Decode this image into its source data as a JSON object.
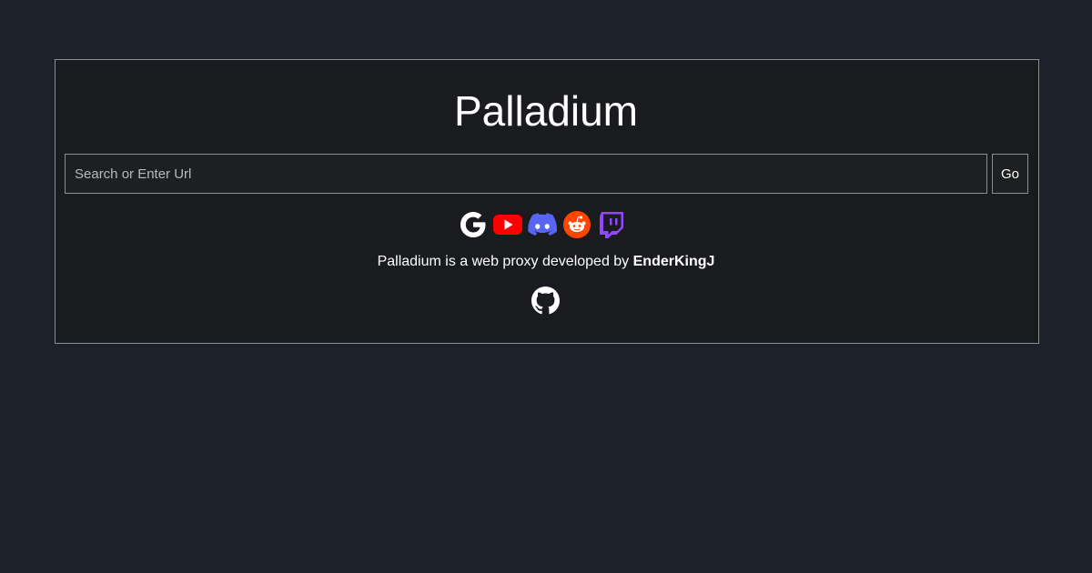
{
  "app": {
    "title": "Palladium"
  },
  "search": {
    "placeholder": "Search or Enter Url",
    "value": "",
    "go_label": "Go"
  },
  "shortcuts": [
    {
      "name": "Google",
      "icon": "google-icon"
    },
    {
      "name": "YouTube",
      "icon": "youtube-icon"
    },
    {
      "name": "Discord",
      "icon": "discord-icon"
    },
    {
      "name": "Reddit",
      "icon": "reddit-icon"
    },
    {
      "name": "Twitch",
      "icon": "twitch-icon"
    }
  ],
  "footer": {
    "credit_prefix": "Palladium is a web proxy developed by ",
    "author": "EnderKingJ",
    "repo_icon": "github-icon"
  },
  "colors": {
    "background": "#1d2129",
    "card": "#191b1f",
    "border": "#8a8d92",
    "youtube": "#ff0000",
    "discord": "#5865f2",
    "reddit": "#ff4500",
    "twitch": "#9146ff"
  }
}
